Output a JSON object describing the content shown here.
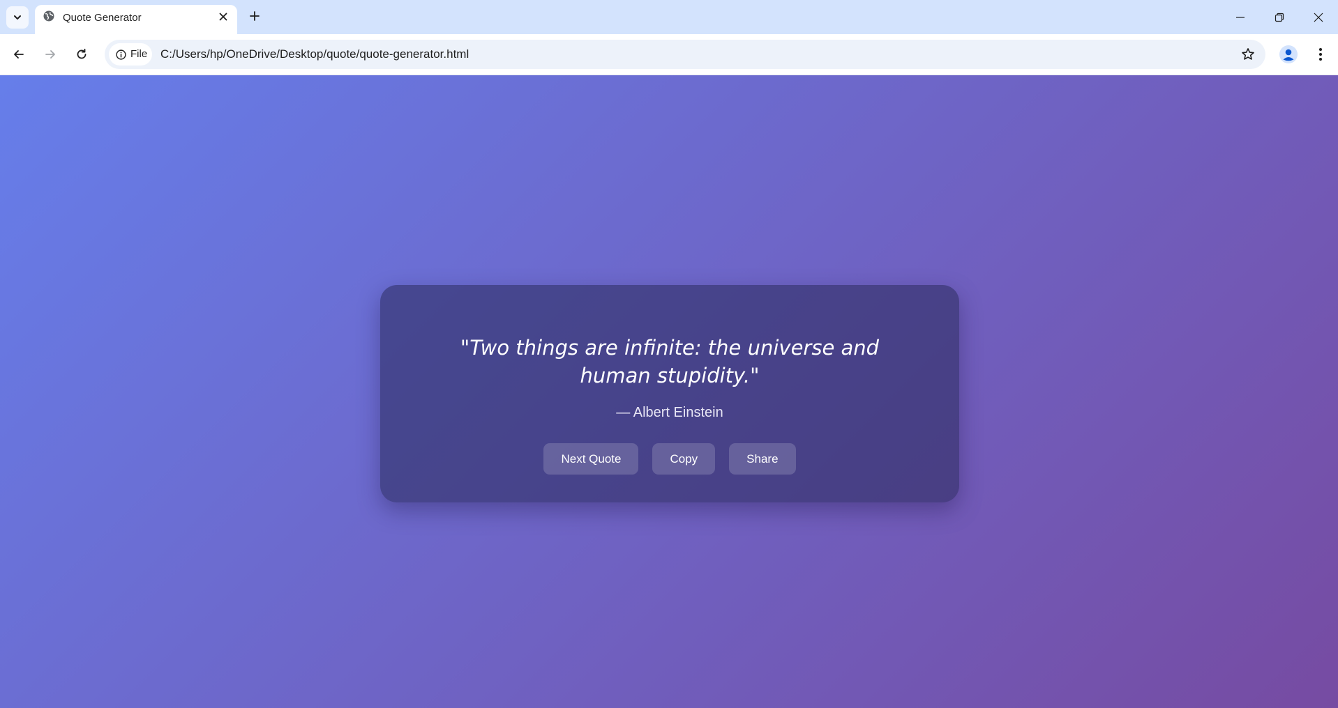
{
  "browser": {
    "tab": {
      "title": "Quote Generator"
    },
    "omnibox": {
      "chip_label": "File",
      "url": "C:/Users/hp/OneDrive/Desktop/quote/quote-generator.html"
    }
  },
  "page": {
    "quote": "\"Two things are infinite: the universe and human stupidity.\"",
    "author": "— Albert Einstein",
    "buttons": {
      "next": "Next Quote",
      "copy": "Copy",
      "share": "Share"
    }
  },
  "colors": {
    "gradient_start": "#667eea",
    "gradient_end": "#764ba2",
    "tabstrip": "#d3e3fd"
  }
}
